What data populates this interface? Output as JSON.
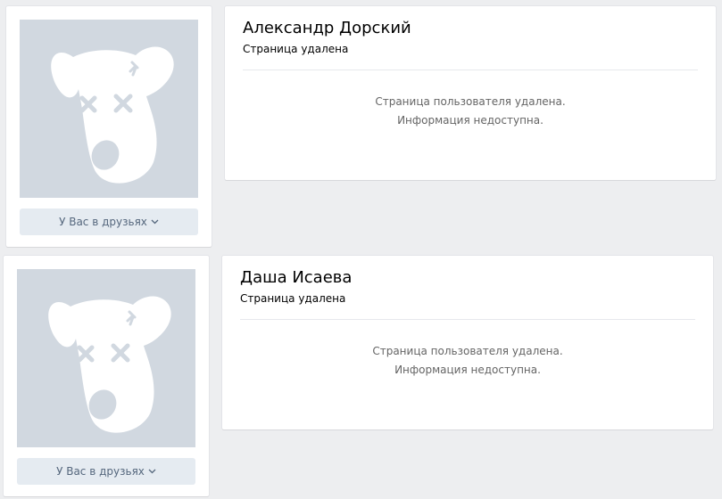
{
  "profiles": [
    {
      "name": "Александр Дорский",
      "status": "Страница удалена",
      "friends_button": "У Вас в друзьях",
      "message_line1": "Страница пользователя удалена.",
      "message_line2": "Информация недоступна."
    },
    {
      "name": "Даша Исаева",
      "status": "Страница удалена",
      "friends_button": "У Вас в друзьях",
      "message_line1": "Страница пользователя удалена.",
      "message_line2": "Информация недоступна."
    }
  ],
  "colors": {
    "background": "#edeef0",
    "avatar_bg": "#d1d8e0",
    "button_bg": "#e5ebf1",
    "button_text": "#55677d",
    "muted_text": "#656565"
  },
  "icons": [
    "deleted-dog-avatar-icon",
    "chevron-down-icon"
  ]
}
